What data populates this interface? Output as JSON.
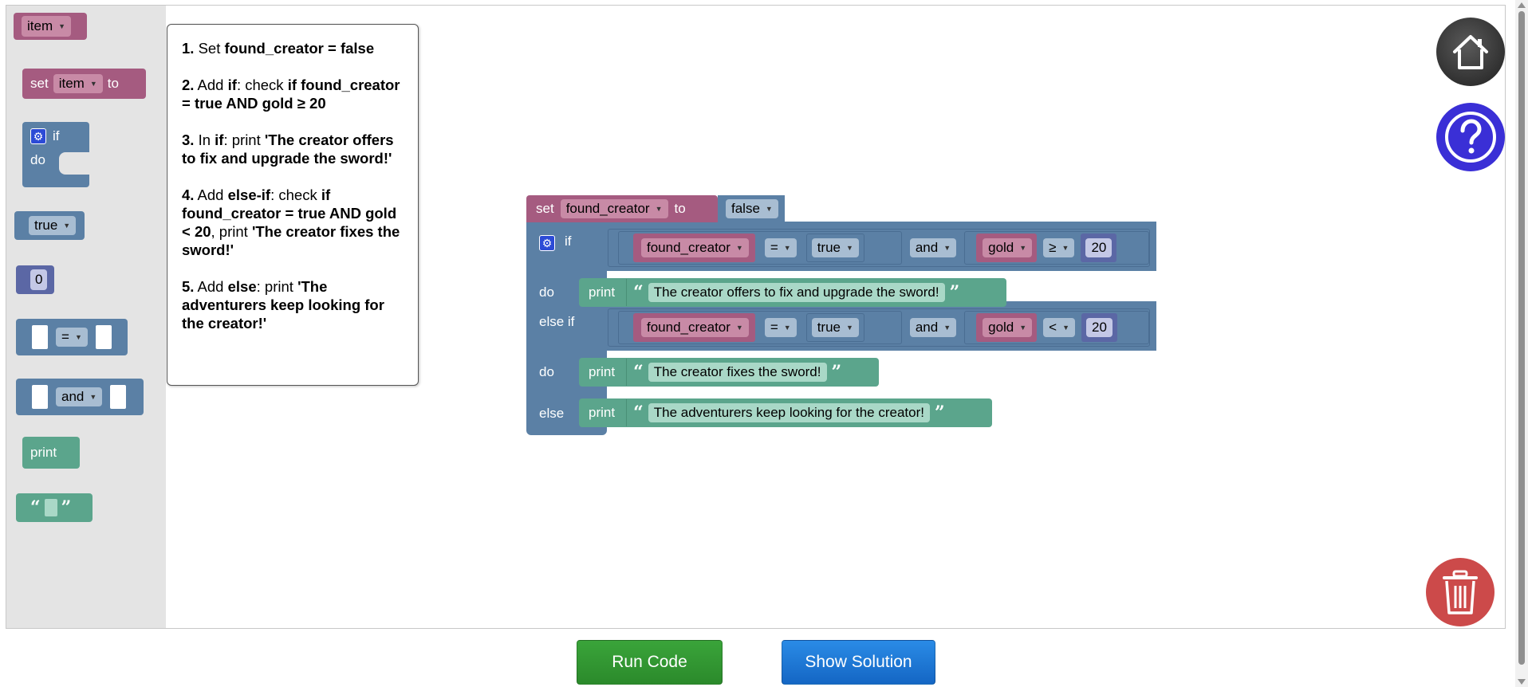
{
  "toolbox": {
    "item_var": "item",
    "set_label": "set",
    "set_var": "item",
    "set_to": "to",
    "if_label": "if",
    "do_label": "do",
    "bool_value": "true",
    "number_value": "0",
    "compare_op": "=",
    "logic_op": "and",
    "print_label": "print"
  },
  "instructions": {
    "steps": [
      {
        "num": "1.",
        "parts": [
          " Set ",
          "found_creator = false"
        ]
      },
      {
        "num": "2.",
        "text": " Add ",
        "if": "if",
        "rest": ": check ",
        "cond": "if found_creator = true AND gold ≥ 20"
      },
      {
        "num": "3.",
        "text": " In ",
        "if": "if",
        "rest": ": print ",
        "cond": "'The creator offers to fix and upgrade the sword!'"
      },
      {
        "num": "4.",
        "text": " Add ",
        "if": "else-if",
        "rest": ": check ",
        "cond": "if found_creator = true AND gold < 20",
        "rest2": ", print ",
        "cond2": "'The creator fixes the sword!'"
      },
      {
        "num": "5.",
        "text": " Add ",
        "if": "else",
        "rest": ": print ",
        "cond": "'The adventurers keep looking for the creator!'"
      }
    ]
  },
  "program": {
    "set_label": "set",
    "set_var": "found_creator",
    "set_to": "to",
    "set_value": "false",
    "if_label": "if",
    "do_label": "do",
    "elseif_label": "else if",
    "else_label": "else",
    "cond1": {
      "var": "found_creator",
      "op": "=",
      "val": "true",
      "logic": "and",
      "var2": "gold",
      "op2": "≥",
      "num": "20"
    },
    "cond2": {
      "var": "found_creator",
      "op": "=",
      "val": "true",
      "logic": "and",
      "var2": "gold",
      "op2": "<",
      "num": "20"
    },
    "print_label": "print",
    "msg1": "The creator offers to fix and upgrade the sword!",
    "msg2": "The creator fixes the sword!",
    "msg3": "The adventurers keep looking for the creator!"
  },
  "buttons": {
    "run": "Run Code",
    "solution": "Show Solution"
  },
  "icons": {
    "home": "home-icon",
    "help": "question-icon",
    "trash": "trash-icon",
    "gear": "gear-icon"
  },
  "colors": {
    "variable_block": "#a55b80",
    "logic_block": "#5b80a5",
    "text_block": "#5ba58c",
    "number_block": "#5b67a5",
    "run_button": "#2f962f",
    "solution_button": "#1a74d6",
    "trash_button": "#cc4a4a",
    "help_button": "#3a2fd6"
  }
}
